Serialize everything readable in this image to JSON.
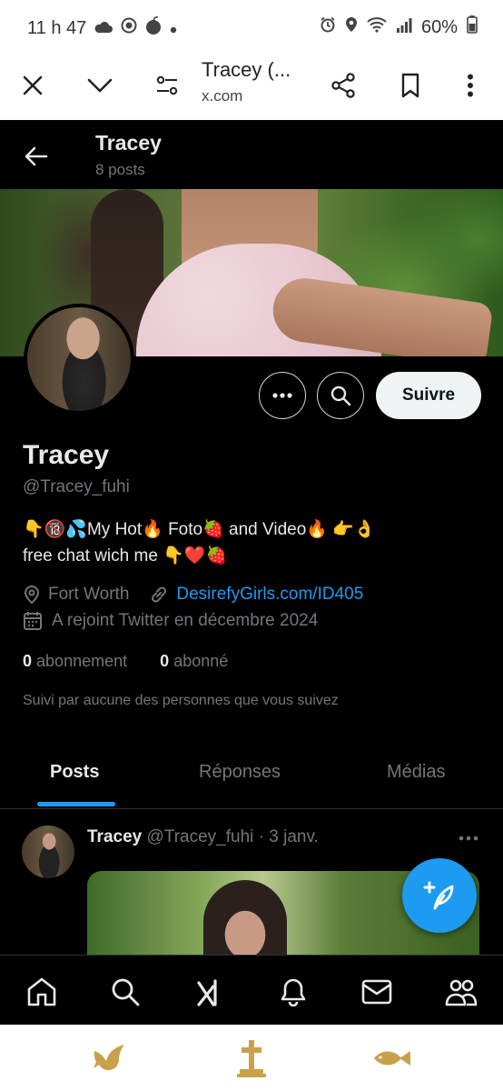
{
  "status_bar": {
    "time": "11 h 47",
    "battery": "60%",
    "icons": [
      "cloud-icon",
      "record-icon",
      "apple-icon",
      "dot-icon",
      "alarm-icon",
      "location-icon",
      "wifi-icon",
      "signal-icon",
      "battery-icon"
    ]
  },
  "browser": {
    "title": "Tracey (...",
    "domain": "x.com",
    "icons": [
      "close-icon",
      "chevron-down-icon",
      "tune-icon",
      "share-icon",
      "bookmark-icon",
      "more-vertical-icon"
    ]
  },
  "header": {
    "name": "Tracey",
    "posts_count": "8 posts"
  },
  "profile": {
    "name": "Tracey",
    "handle": "@Tracey_fuhi",
    "bio_line1": "👇🔞💦My Hot🔥 Foto🍓 and Video🔥 👉👌",
    "bio_line2": "free chat wich me 👇❤️🍓",
    "location": "Fort Worth",
    "website": "DesirefyGirls.com/ID405",
    "joined": "A rejoint Twitter en décembre 2024",
    "following_count": "0",
    "following_label": "abonnement",
    "followers_count": "0",
    "followers_label": "abonné",
    "followed_by": "Suivi par aucune des personnes que vous suivez",
    "follow_button": "Suivre"
  },
  "tabs": [
    {
      "label": "Posts",
      "active": true
    },
    {
      "label": "Réponses",
      "active": false
    },
    {
      "label": "Médias",
      "active": false
    }
  ],
  "post": {
    "author": "Tracey",
    "handle": "@Tracey_fuhi",
    "separator": "·",
    "date": "3 janv."
  },
  "bottom_nav": [
    "home-icon",
    "search-icon",
    "grok-icon",
    "notifications-icon",
    "messages-icon",
    "communities-icon"
  ],
  "system_nav": [
    "dove-icon",
    "cross-icon",
    "fish-icon"
  ],
  "colors": {
    "accent": "#1d9bf0",
    "background": "#000000",
    "text_primary": "#e7e9ea",
    "text_secondary": "#71767b",
    "border": "#2f3336",
    "gold": "#c9a14a"
  }
}
